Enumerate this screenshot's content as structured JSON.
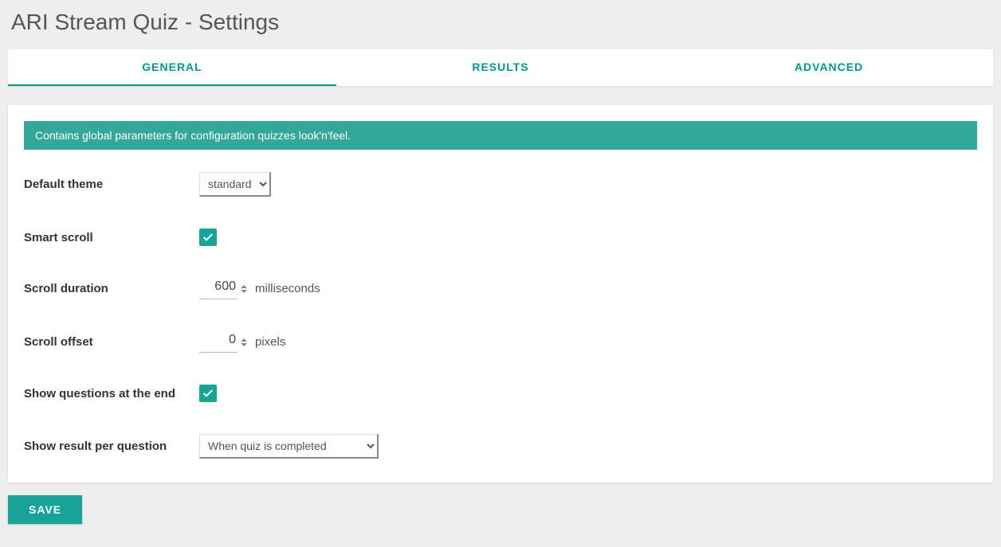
{
  "page_title": "ARI Stream Quiz - Settings",
  "tabs": [
    {
      "label": "GENERAL",
      "active": true
    },
    {
      "label": "RESULTS",
      "active": false
    },
    {
      "label": "ADVANCED",
      "active": false
    }
  ],
  "banner_text": "Contains global parameters for configuration quizzes look'n'feel.",
  "fields": {
    "default_theme": {
      "label": "Default theme",
      "value": "standard"
    },
    "smart_scroll": {
      "label": "Smart scroll",
      "checked": true
    },
    "scroll_duration": {
      "label": "Scroll duration",
      "value": "600",
      "unit": "milliseconds"
    },
    "scroll_offset": {
      "label": "Scroll offset",
      "value": "0",
      "unit": "pixels"
    },
    "show_questions_end": {
      "label": "Show questions at the end",
      "checked": true
    },
    "show_result_per_question": {
      "label": "Show result per question",
      "value": "When quiz is completed"
    }
  },
  "save_label": "SAVE"
}
